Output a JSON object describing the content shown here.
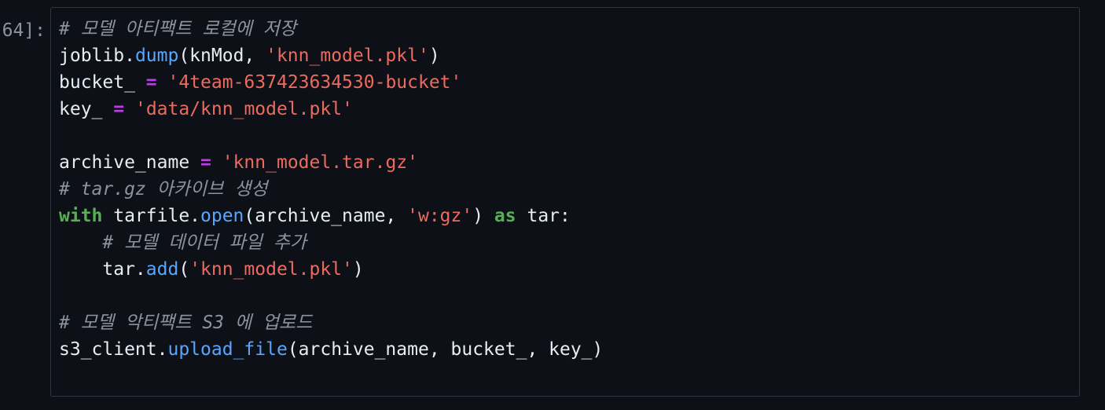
{
  "prompt_label": "[64]:",
  "lines": [
    [
      {
        "t": "# 모델 아티팩트 로컬에 저장",
        "k": "comment"
      }
    ],
    [
      {
        "t": "joblib.",
        "k": "name"
      },
      {
        "t": "dump",
        "k": "func"
      },
      {
        "t": "(knMod, ",
        "k": "name"
      },
      {
        "t": "'knn_model.pkl'",
        "k": "string"
      },
      {
        "t": ")",
        "k": "name"
      }
    ],
    [
      {
        "t": "bucket_ ",
        "k": "name"
      },
      {
        "t": "=",
        "k": "op"
      },
      {
        "t": " ",
        "k": "name"
      },
      {
        "t": "'4team-637423634530-bucket'",
        "k": "string"
      }
    ],
    [
      {
        "t": "key_ ",
        "k": "name"
      },
      {
        "t": "=",
        "k": "op"
      },
      {
        "t": " ",
        "k": "name"
      },
      {
        "t": "'data/knn_model.pkl'",
        "k": "string"
      }
    ],
    [],
    [
      {
        "t": "archive_name ",
        "k": "name"
      },
      {
        "t": "=",
        "k": "op"
      },
      {
        "t": " ",
        "k": "name"
      },
      {
        "t": "'knn_model.tar.gz'",
        "k": "string"
      }
    ],
    [
      {
        "t": "# tar.gz 아카이브 생성",
        "k": "comment"
      }
    ],
    [
      {
        "t": "with",
        "k": "keyword"
      },
      {
        "t": " tarfile.",
        "k": "name"
      },
      {
        "t": "open",
        "k": "func"
      },
      {
        "t": "(archive_name, ",
        "k": "name"
      },
      {
        "t": "'w:gz'",
        "k": "string"
      },
      {
        "t": ") ",
        "k": "name"
      },
      {
        "t": "as",
        "k": "keyword"
      },
      {
        "t": " tar:",
        "k": "name"
      }
    ],
    [
      {
        "t": "    ",
        "k": "name"
      },
      {
        "t": "# 모델 데이터 파일 추가",
        "k": "comment"
      }
    ],
    [
      {
        "t": "    tar.",
        "k": "name"
      },
      {
        "t": "add",
        "k": "func"
      },
      {
        "t": "(",
        "k": "name"
      },
      {
        "t": "'knn_model.pkl'",
        "k": "string"
      },
      {
        "t": ")",
        "k": "name"
      }
    ],
    [],
    [
      {
        "t": "# 모델 악티팩트 S3 에 업로드",
        "k": "comment"
      }
    ],
    [
      {
        "t": "s3_client.",
        "k": "name"
      },
      {
        "t": "upload_file",
        "k": "func"
      },
      {
        "t": "(archive_name, bucket_, key_)",
        "k": "name"
      }
    ]
  ],
  "colors": {
    "background": "#0d1117",
    "comment": "#8b949e",
    "string": "#ec6a5e",
    "func": "#58a6ff",
    "op": "#bc3fe6",
    "keyword": "#56b14f",
    "text": "#e6edf3"
  }
}
